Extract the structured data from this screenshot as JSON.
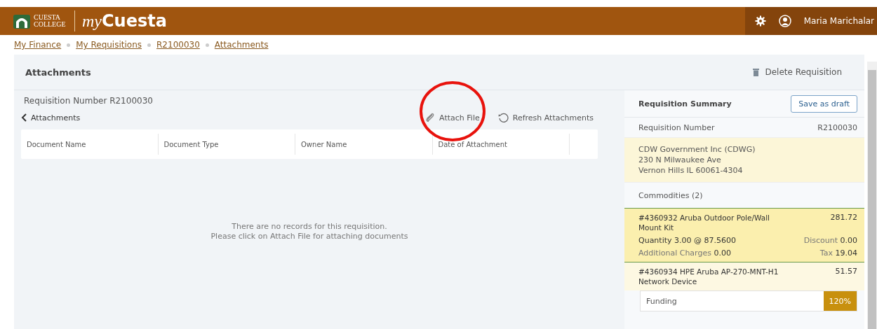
{
  "header": {
    "logo_text": "CUESTA COLLEGE",
    "app_name_prefix": "my",
    "app_name": "Cuesta",
    "user_name": "Maria Marichalar"
  },
  "breadcrumbs": [
    "My Finance",
    "My Requisitions",
    "R2100030",
    "Attachments"
  ],
  "page_title": "Attachments",
  "delete_action": "Delete Requisition",
  "requisition_label": "Requisition Number R2100030",
  "back_link": "Attachments",
  "actions": [
    {
      "kind": "attach",
      "label": "Attach File"
    },
    {
      "kind": "refresh",
      "label": "Refresh Attachments"
    }
  ],
  "table": {
    "columns": [
      "Document Name",
      "Document Type",
      "Owner Name",
      "Date of Attachment"
    ]
  },
  "empty_message": [
    "There are no records for this requisition.",
    "Please click on Attach File for attaching documents"
  ],
  "summary": {
    "title": "Requisition Summary",
    "save_button": "Save as draft",
    "number_label": "Requisition Number",
    "number_value": "R2100030",
    "vendor": [
      "CDW Government Inc (CDWG)",
      "230 N Milwaukee Ave",
      "Vernon Hills IL 60061-4304"
    ],
    "commodities_label": "Commodities (2)",
    "commodities": [
      {
        "title": "#4360932 Aruba Outdoor Pole/Wall Mount Kit",
        "amount": "281.72",
        "selected": true,
        "quantity": "Quantity 3.00 @ 87.5600",
        "discount_label": "Discount",
        "discount": "0.00",
        "charges_label": "Additional Charges",
        "charges": "0.00",
        "tax_label": "Tax",
        "tax": "19.04"
      },
      {
        "title": "#4360934 HPE Aruba AP-270-MNT-H1 Network Device",
        "amount": "51.57",
        "selected": false
      }
    ],
    "funding_label": "Funding",
    "funding_value": "120%"
  }
}
